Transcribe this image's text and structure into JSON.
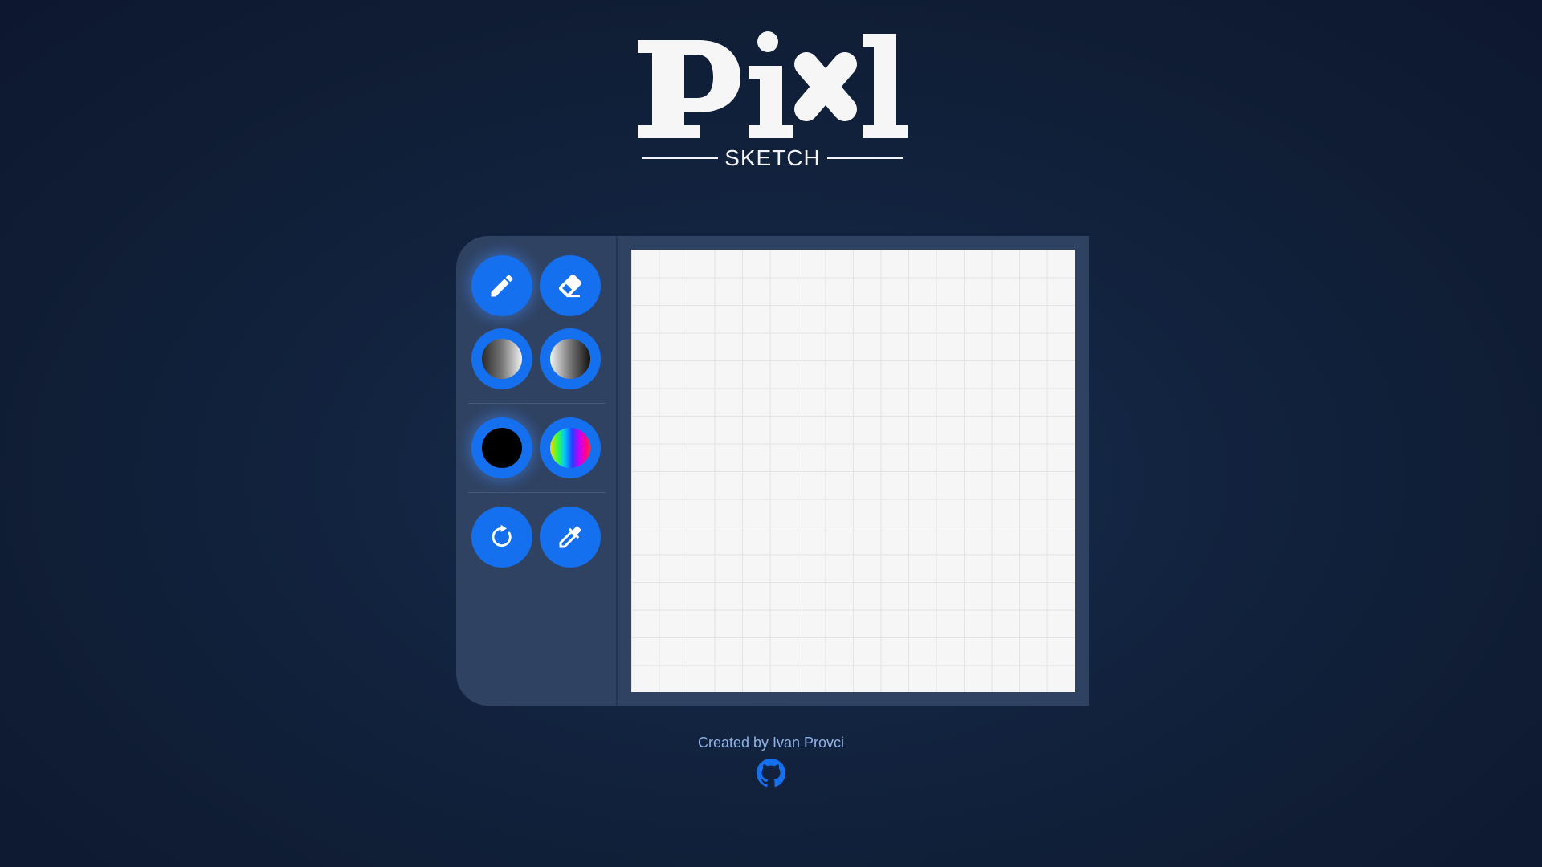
{
  "logo": {
    "wordmark": "Pixl",
    "tagline": "SKETCH"
  },
  "toolbar": {
    "tools": [
      {
        "name": "pencil",
        "icon": "pencil-icon",
        "active": true
      },
      {
        "name": "eraser",
        "icon": "eraser-icon",
        "active": false
      },
      {
        "name": "lighten",
        "icon": "lighten-shade-icon",
        "active": false
      },
      {
        "name": "darken",
        "icon": "darken-shade-icon",
        "active": false
      },
      {
        "name": "color-black",
        "icon": "black-color-swatch",
        "active": true
      },
      {
        "name": "color-rainbow",
        "icon": "rainbow-color-swatch",
        "active": false
      },
      {
        "name": "reset",
        "icon": "reset-icon",
        "active": false
      },
      {
        "name": "color-picker",
        "icon": "eyedropper-icon",
        "active": false
      }
    ]
  },
  "canvas": {
    "grid": "16x16",
    "background_color": "#f6f6f7"
  },
  "footer": {
    "credit": "Created by Ivan Provci",
    "link_icon": "github-icon"
  },
  "colors": {
    "accent": "#1570f0",
    "panel": "#2f4261",
    "background": "#12233f",
    "credit_text": "#8fb2e6"
  }
}
